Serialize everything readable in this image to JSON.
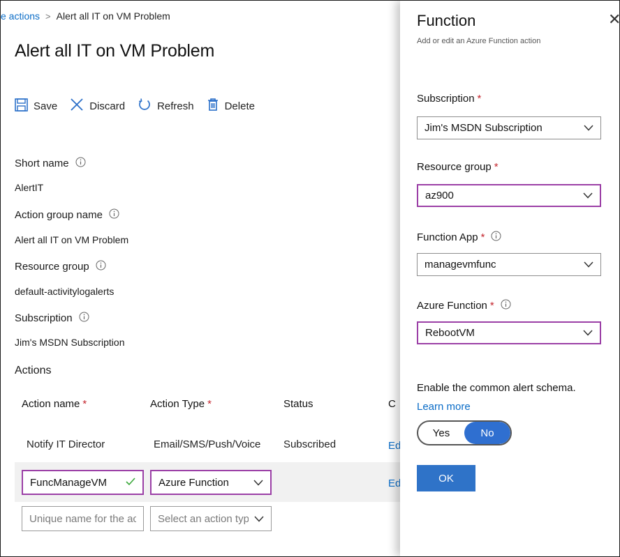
{
  "breadcrumb": {
    "parent": "e actions",
    "separator": ">",
    "current": "Alert all IT on VM Problem"
  },
  "page_title": "Alert all IT on VM Problem",
  "toolbar": {
    "save": "Save",
    "discard": "Discard",
    "refresh": "Refresh",
    "delete": "Delete"
  },
  "details": {
    "short_name_label": "Short name",
    "short_name_value": "AlertIT",
    "action_group_label": "Action group name",
    "action_group_value": "Alert all IT on VM Problem",
    "resource_group_label": "Resource group",
    "resource_group_value": "default-activitylogalerts",
    "subscription_label": "Subscription",
    "subscription_value": "Jim's MSDN Subscription"
  },
  "actions_heading": "Actions",
  "table": {
    "headers": {
      "name": "Action name",
      "type": "Action Type",
      "status": "Status",
      "configure": "C"
    },
    "required_mark": "*",
    "row1": {
      "name": "Notify IT Director",
      "type": "Email/SMS/Push/Voice",
      "status": "Subscribed",
      "edit": "Ed"
    },
    "row2": {
      "name": "FuncManageVM",
      "type": "Azure Function",
      "edit": "Ed"
    },
    "new_row": {
      "name_placeholder": "Unique name for the ac...",
      "type_placeholder": "Select an action type"
    }
  },
  "panel": {
    "title": "Function",
    "subtitle": "Add or edit an Azure Function action",
    "close": "✕",
    "subscription_label": "Subscription",
    "subscription_value": "Jim's MSDN Subscription",
    "resource_group_label": "Resource group",
    "resource_group_value": "az900",
    "function_app_label": "Function App",
    "function_app_value": "managevmfunc",
    "azure_function_label": "Azure Function",
    "azure_function_value": "RebootVM",
    "schema_text": "Enable the common alert schema. ",
    "schema_link": "Learn more",
    "toggle_yes": "Yes",
    "toggle_no": "No",
    "toggle_selected": "No",
    "ok": "OK"
  },
  "colors": {
    "accent": "#2f73c8",
    "link": "#0a6cc7",
    "required": "#c4262e",
    "focus_border": "#9b3fa6",
    "valid_check": "#3aa83a"
  }
}
